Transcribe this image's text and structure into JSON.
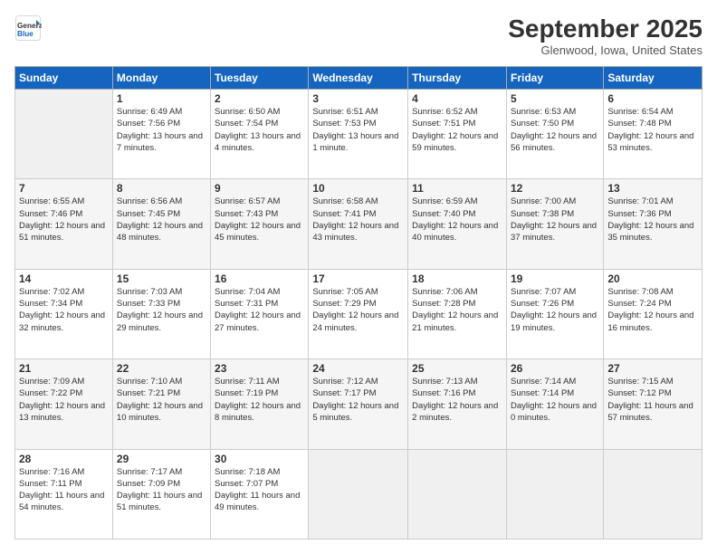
{
  "header": {
    "logo_general": "General",
    "logo_blue": "Blue",
    "month_title": "September 2025",
    "location": "Glenwood, Iowa, United States"
  },
  "days_of_week": [
    "Sunday",
    "Monday",
    "Tuesday",
    "Wednesday",
    "Thursday",
    "Friday",
    "Saturday"
  ],
  "weeks": [
    [
      {
        "day": "",
        "sunrise": "",
        "sunset": "",
        "daylight": ""
      },
      {
        "day": "1",
        "sunrise": "Sunrise: 6:49 AM",
        "sunset": "Sunset: 7:56 PM",
        "daylight": "Daylight: 13 hours and 7 minutes."
      },
      {
        "day": "2",
        "sunrise": "Sunrise: 6:50 AM",
        "sunset": "Sunset: 7:54 PM",
        "daylight": "Daylight: 13 hours and 4 minutes."
      },
      {
        "day": "3",
        "sunrise": "Sunrise: 6:51 AM",
        "sunset": "Sunset: 7:53 PM",
        "daylight": "Daylight: 13 hours and 1 minute."
      },
      {
        "day": "4",
        "sunrise": "Sunrise: 6:52 AM",
        "sunset": "Sunset: 7:51 PM",
        "daylight": "Daylight: 12 hours and 59 minutes."
      },
      {
        "day": "5",
        "sunrise": "Sunrise: 6:53 AM",
        "sunset": "Sunset: 7:50 PM",
        "daylight": "Daylight: 12 hours and 56 minutes."
      },
      {
        "day": "6",
        "sunrise": "Sunrise: 6:54 AM",
        "sunset": "Sunset: 7:48 PM",
        "daylight": "Daylight: 12 hours and 53 minutes."
      }
    ],
    [
      {
        "day": "7",
        "sunrise": "Sunrise: 6:55 AM",
        "sunset": "Sunset: 7:46 PM",
        "daylight": "Daylight: 12 hours and 51 minutes."
      },
      {
        "day": "8",
        "sunrise": "Sunrise: 6:56 AM",
        "sunset": "Sunset: 7:45 PM",
        "daylight": "Daylight: 12 hours and 48 minutes."
      },
      {
        "day": "9",
        "sunrise": "Sunrise: 6:57 AM",
        "sunset": "Sunset: 7:43 PM",
        "daylight": "Daylight: 12 hours and 45 minutes."
      },
      {
        "day": "10",
        "sunrise": "Sunrise: 6:58 AM",
        "sunset": "Sunset: 7:41 PM",
        "daylight": "Daylight: 12 hours and 43 minutes."
      },
      {
        "day": "11",
        "sunrise": "Sunrise: 6:59 AM",
        "sunset": "Sunset: 7:40 PM",
        "daylight": "Daylight: 12 hours and 40 minutes."
      },
      {
        "day": "12",
        "sunrise": "Sunrise: 7:00 AM",
        "sunset": "Sunset: 7:38 PM",
        "daylight": "Daylight: 12 hours and 37 minutes."
      },
      {
        "day": "13",
        "sunrise": "Sunrise: 7:01 AM",
        "sunset": "Sunset: 7:36 PM",
        "daylight": "Daylight: 12 hours and 35 minutes."
      }
    ],
    [
      {
        "day": "14",
        "sunrise": "Sunrise: 7:02 AM",
        "sunset": "Sunset: 7:34 PM",
        "daylight": "Daylight: 12 hours and 32 minutes."
      },
      {
        "day": "15",
        "sunrise": "Sunrise: 7:03 AM",
        "sunset": "Sunset: 7:33 PM",
        "daylight": "Daylight: 12 hours and 29 minutes."
      },
      {
        "day": "16",
        "sunrise": "Sunrise: 7:04 AM",
        "sunset": "Sunset: 7:31 PM",
        "daylight": "Daylight: 12 hours and 27 minutes."
      },
      {
        "day": "17",
        "sunrise": "Sunrise: 7:05 AM",
        "sunset": "Sunset: 7:29 PM",
        "daylight": "Daylight: 12 hours and 24 minutes."
      },
      {
        "day": "18",
        "sunrise": "Sunrise: 7:06 AM",
        "sunset": "Sunset: 7:28 PM",
        "daylight": "Daylight: 12 hours and 21 minutes."
      },
      {
        "day": "19",
        "sunrise": "Sunrise: 7:07 AM",
        "sunset": "Sunset: 7:26 PM",
        "daylight": "Daylight: 12 hours and 19 minutes."
      },
      {
        "day": "20",
        "sunrise": "Sunrise: 7:08 AM",
        "sunset": "Sunset: 7:24 PM",
        "daylight": "Daylight: 12 hours and 16 minutes."
      }
    ],
    [
      {
        "day": "21",
        "sunrise": "Sunrise: 7:09 AM",
        "sunset": "Sunset: 7:22 PM",
        "daylight": "Daylight: 12 hours and 13 minutes."
      },
      {
        "day": "22",
        "sunrise": "Sunrise: 7:10 AM",
        "sunset": "Sunset: 7:21 PM",
        "daylight": "Daylight: 12 hours and 10 minutes."
      },
      {
        "day": "23",
        "sunrise": "Sunrise: 7:11 AM",
        "sunset": "Sunset: 7:19 PM",
        "daylight": "Daylight: 12 hours and 8 minutes."
      },
      {
        "day": "24",
        "sunrise": "Sunrise: 7:12 AM",
        "sunset": "Sunset: 7:17 PM",
        "daylight": "Daylight: 12 hours and 5 minutes."
      },
      {
        "day": "25",
        "sunrise": "Sunrise: 7:13 AM",
        "sunset": "Sunset: 7:16 PM",
        "daylight": "Daylight: 12 hours and 2 minutes."
      },
      {
        "day": "26",
        "sunrise": "Sunrise: 7:14 AM",
        "sunset": "Sunset: 7:14 PM",
        "daylight": "Daylight: 12 hours and 0 minutes."
      },
      {
        "day": "27",
        "sunrise": "Sunrise: 7:15 AM",
        "sunset": "Sunset: 7:12 PM",
        "daylight": "Daylight: 11 hours and 57 minutes."
      }
    ],
    [
      {
        "day": "28",
        "sunrise": "Sunrise: 7:16 AM",
        "sunset": "Sunset: 7:11 PM",
        "daylight": "Daylight: 11 hours and 54 minutes."
      },
      {
        "day": "29",
        "sunrise": "Sunrise: 7:17 AM",
        "sunset": "Sunset: 7:09 PM",
        "daylight": "Daylight: 11 hours and 51 minutes."
      },
      {
        "day": "30",
        "sunrise": "Sunrise: 7:18 AM",
        "sunset": "Sunset: 7:07 PM",
        "daylight": "Daylight: 11 hours and 49 minutes."
      },
      {
        "day": "",
        "sunrise": "",
        "sunset": "",
        "daylight": ""
      },
      {
        "day": "",
        "sunrise": "",
        "sunset": "",
        "daylight": ""
      },
      {
        "day": "",
        "sunrise": "",
        "sunset": "",
        "daylight": ""
      },
      {
        "day": "",
        "sunrise": "",
        "sunset": "",
        "daylight": ""
      }
    ]
  ]
}
